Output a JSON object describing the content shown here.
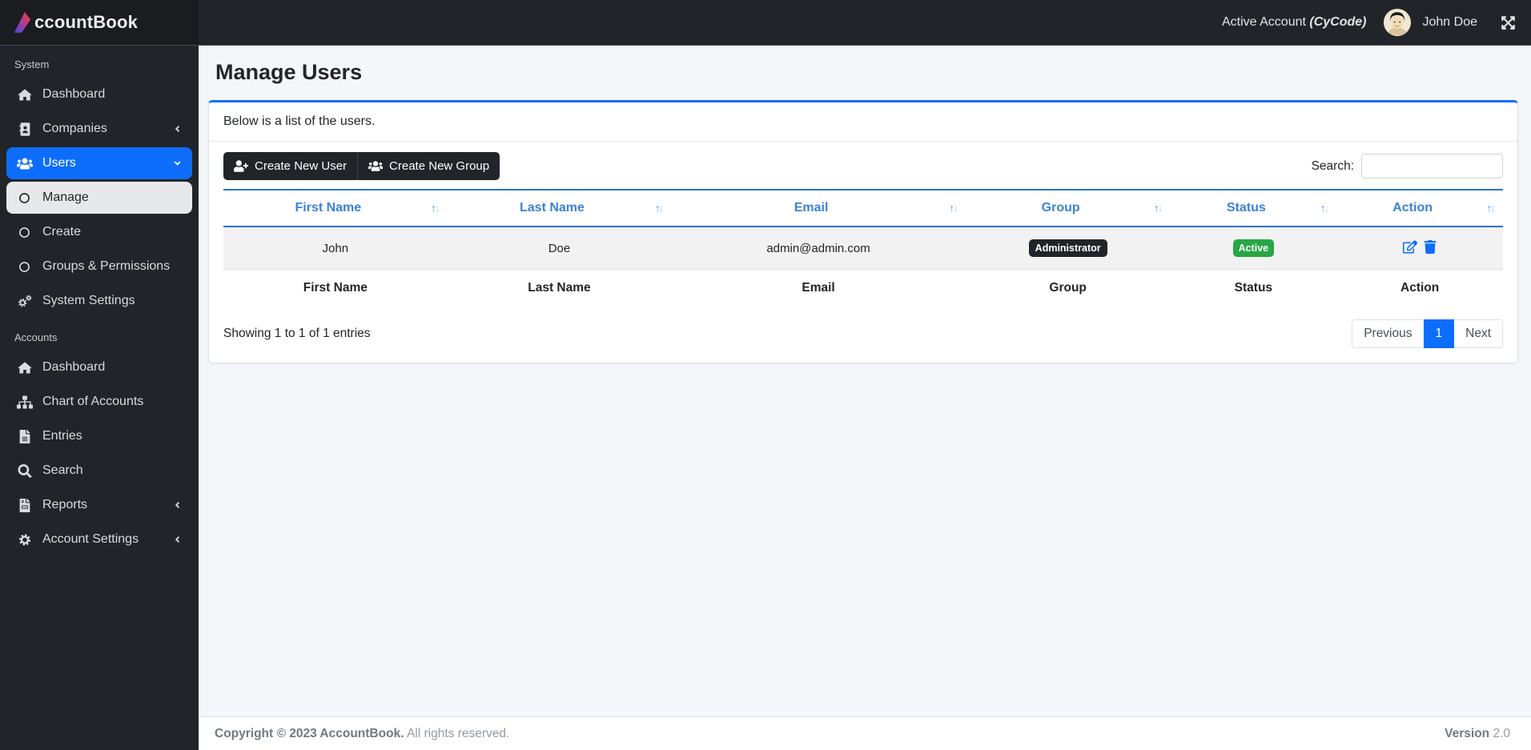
{
  "brand": {
    "name_prefix": "A",
    "name_rest": "ccountBook",
    "full_name": "AccountBook"
  },
  "topbar": {
    "active_account_label": "Active Account ",
    "active_account_code": "(CyCode)",
    "user_name": "John Doe",
    "expand_icon": "expand-arrows-icon",
    "avatar_icon": "user-avatar"
  },
  "sidebar": {
    "sections": [
      {
        "label": "System",
        "items": [
          {
            "label": "Dashboard",
            "icon": "home-icon"
          },
          {
            "label": "Companies",
            "icon": "address-book-icon",
            "chevron": "left"
          },
          {
            "label": "Users",
            "icon": "users-icon",
            "chevron": "down",
            "state": "active"
          },
          {
            "label": "Manage",
            "icon": "circle-icon",
            "submenu": true,
            "state": "selected"
          },
          {
            "label": "Create",
            "icon": "circle-icon",
            "submenu": true
          },
          {
            "label": "Groups & Permissions",
            "icon": "circle-icon",
            "submenu": true
          },
          {
            "label": "System Settings",
            "icon": "cogs-icon"
          }
        ]
      },
      {
        "label": "Accounts",
        "items": [
          {
            "label": "Dashboard",
            "icon": "home-icon"
          },
          {
            "label": "Chart of Accounts",
            "icon": "sitemap-icon"
          },
          {
            "label": "Entries",
            "icon": "file-icon"
          },
          {
            "label": "Search",
            "icon": "search-icon"
          },
          {
            "label": "Reports",
            "icon": "file-invoice-icon",
            "chevron": "left"
          },
          {
            "label": "Account Settings",
            "icon": "cog-icon",
            "chevron": "left"
          }
        ]
      }
    ]
  },
  "page": {
    "title": "Manage Users"
  },
  "card": {
    "header_text": "Below is a list of the users.",
    "buttons": [
      {
        "label": "Create New User",
        "icon": "user-plus-icon"
      },
      {
        "label": "Create New Group",
        "icon": "users-icon"
      }
    ],
    "search_label": "Search:",
    "search_value": "",
    "table": {
      "columns": [
        "First Name",
        "Last Name",
        "Email",
        "Group",
        "Status",
        "Action"
      ],
      "sort_up": "↑",
      "sort_down": "↓",
      "rows": [
        {
          "first_name": "John",
          "last_name": "Doe",
          "email": "admin@admin.com",
          "group": "Administrator",
          "status": "Active",
          "actions": [
            "edit-icon",
            "trash-icon"
          ]
        }
      ],
      "footer_columns": [
        "First Name",
        "Last Name",
        "Email",
        "Group",
        "Status",
        "Action"
      ]
    },
    "info": "Showing 1 to 1 of 1 entries",
    "pagination": {
      "previous": "Previous",
      "current": "1",
      "next": "Next"
    }
  },
  "footer": {
    "copyright_strong": "Copyright © 2023 AccountBook.",
    "copyright_rest": " All rights reserved.",
    "version_label": "Version",
    "version_value": " 2.0"
  },
  "colors": {
    "accent_blue": "#0d6efd",
    "table_header_blue": "#3b82d9",
    "table_border_blue": "#2b74c6",
    "sidebar_bg": "#212529",
    "brand_bg": "#1a1c1f",
    "badge_dark": "#212529",
    "badge_green": "#28a745",
    "content_bg": "#f4f6f9",
    "row_stripe": "#f2f2f2"
  }
}
